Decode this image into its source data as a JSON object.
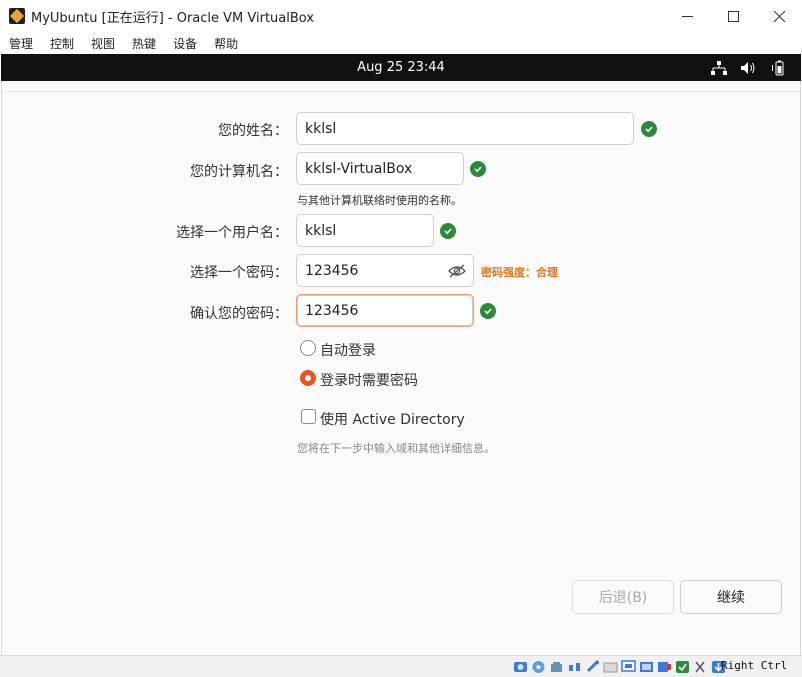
{
  "window": {
    "title": "MyUbuntu [正在运行] - Oracle VM VirtualBox",
    "minimize": "—",
    "maximize": "☐",
    "close": "✕"
  },
  "menu": [
    "管理",
    "控制",
    "视图",
    "热键",
    "设备",
    "帮助"
  ],
  "guest_bar": {
    "clock": "Aug 25  23:44",
    "tray_icons": [
      "network-icon",
      "volume-icon",
      "battery-icon"
    ]
  },
  "form": {
    "name_label": "您的姓名：",
    "name_value": "kklsl",
    "computer_label": "您的计算机名：",
    "computer_value": "kklsl-VirtualBox",
    "computer_hint": "与其他计算机联络时使用的名称。",
    "username_label": "选择一个用户名：",
    "username_value": "kklsl",
    "password_label": "选择一个密码：",
    "password_value": "123456",
    "password_strength": "密码强度：合理",
    "confirm_label": "确认您的密码：",
    "confirm_value": "123456",
    "auto_login_label": "自动登录",
    "require_password_label": "登录时需要密码",
    "ad_label": "使用 Active Directory",
    "ad_note": "您将在下一步中输入域和其他详细信息。"
  },
  "buttons": {
    "back": "后退(B)",
    "continue": "继续"
  },
  "status": {
    "host_key": "Right Ctrl"
  },
  "colors": {
    "accent": "#e95420",
    "ok": "#2a8a3a",
    "strength": "#e0781f"
  }
}
